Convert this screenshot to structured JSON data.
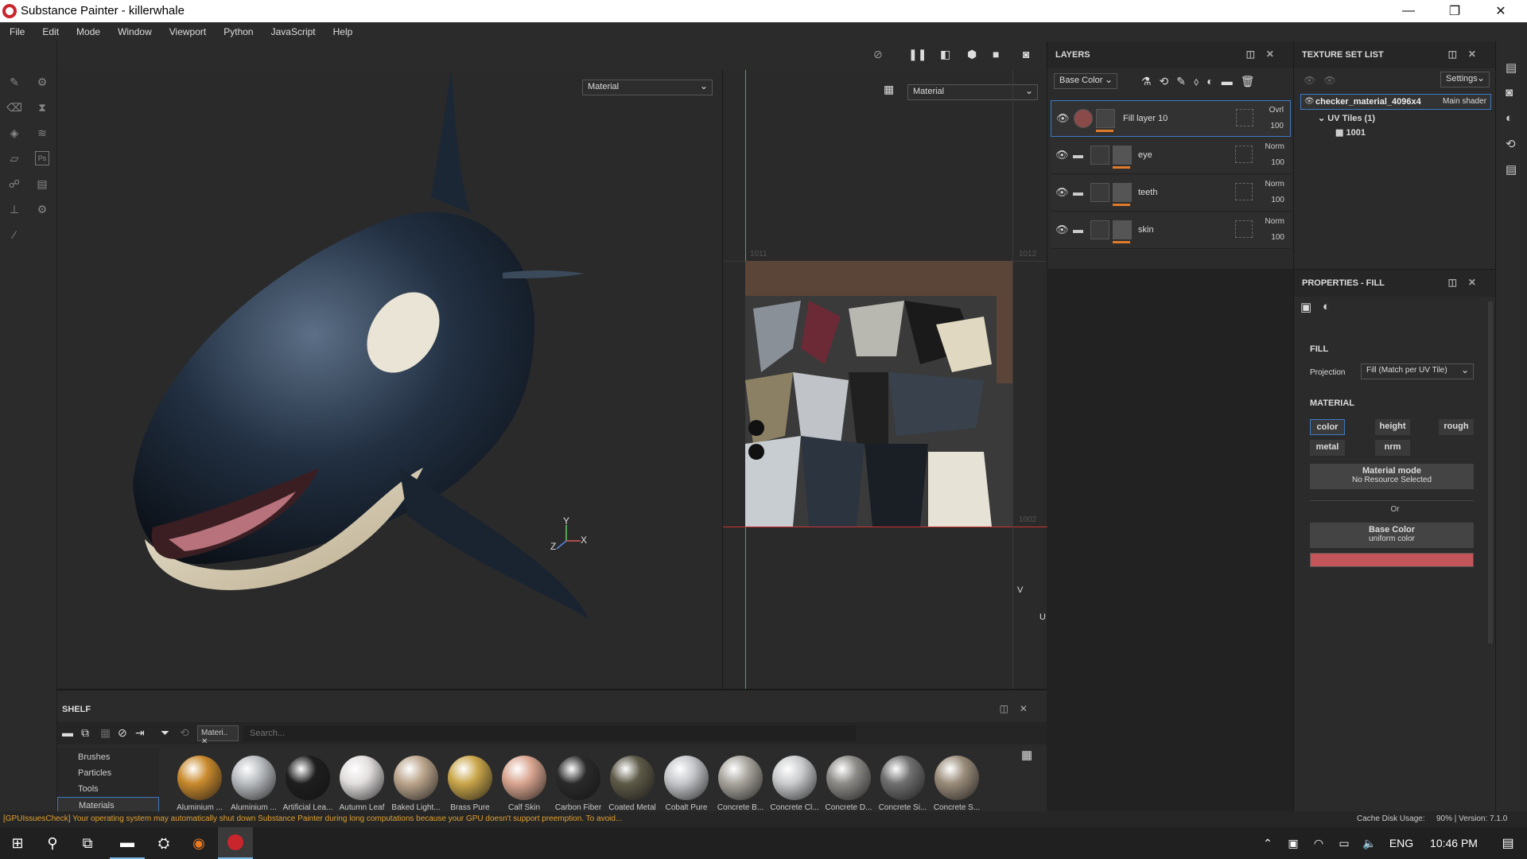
{
  "window": {
    "title": "Substance Painter - killerwhale"
  },
  "menubar": [
    "File",
    "Edit",
    "Mode",
    "Window",
    "Viewport",
    "Python",
    "JavaScript",
    "Help"
  ],
  "viewport3d": {
    "material_select": "Material",
    "axis_y": "Y",
    "axis_z": "Z",
    "axis_x": "X"
  },
  "viewport2d": {
    "material_select": "Material",
    "tile_labels": {
      "tl": "1011",
      "tr": "1012",
      "bl": "1001",
      "br": "1002"
    },
    "axis_v": "V",
    "axis_u": "U"
  },
  "layers": {
    "title": "LAYERS",
    "channel_select": "Base Color",
    "items": [
      {
        "name": "Fill layer 10",
        "blend": "Ovrl",
        "opacity": "100",
        "type": "fill"
      },
      {
        "name": "eye",
        "blend": "Norm",
        "opacity": "100",
        "type": "folder"
      },
      {
        "name": "teeth",
        "blend": "Norm",
        "opacity": "100",
        "type": "folder"
      },
      {
        "name": "skin",
        "blend": "Norm",
        "opacity": "100",
        "type": "folder"
      }
    ]
  },
  "texture_set_list": {
    "title": "TEXTURE SET LIST",
    "settings_label": "Settings",
    "set_name": "checker_material_4096x4",
    "shader": "Main shader",
    "uv_tiles": "UV Tiles (1)",
    "tile": "1001"
  },
  "properties": {
    "title": "PROPERTIES - FILL",
    "fill_section": "FILL",
    "projection_label": "Projection",
    "projection_value": "Fill (Match per UV Tile)",
    "material_section": "MATERIAL",
    "channels": [
      "color",
      "height",
      "rough",
      "metal",
      "nrm"
    ],
    "material_mode_title": "Material mode",
    "material_mode_value": "No Resource Selected",
    "or_label": "Or",
    "base_color_title": "Base Color",
    "base_color_value": "uniform color",
    "base_color_swatch": "#c4555b"
  },
  "shelf": {
    "title": "SHELF",
    "filter_tag": "Materi..",
    "search_placeholder": "Search...",
    "categories": [
      "Brushes",
      "Particles",
      "Tools",
      "Materials"
    ],
    "materials": [
      {
        "label": "Aluminium ...",
        "color": "#c98a2d"
      },
      {
        "label": "Aluminium ...",
        "color": "#b9bcc0"
      },
      {
        "label": "Artificial Lea...",
        "color": "#1e1e1e"
      },
      {
        "label": "Autumn Leaf",
        "color": "#e2dede"
      },
      {
        "label": "Baked Light...",
        "color": "#bba58c"
      },
      {
        "label": "Brass Pure",
        "color": "#c9a64a"
      },
      {
        "label": "Calf Skin",
        "color": "#d9a590"
      },
      {
        "label": "Carbon Fiber",
        "color": "#2a2a2a"
      },
      {
        "label": "Coated Metal",
        "color": "#5e5a48"
      },
      {
        "label": "Cobalt Pure",
        "color": "#c4c6c9"
      },
      {
        "label": "Concrete B...",
        "color": "#a9a59e"
      },
      {
        "label": "Concrete Cl...",
        "color": "#c9cbcc"
      },
      {
        "label": "Concrete D...",
        "color": "#8c8b88"
      },
      {
        "label": "Concrete Si...",
        "color": "#6f6f6f"
      },
      {
        "label": "Concrete S...",
        "color": "#9a8c7a"
      }
    ]
  },
  "status": {
    "warning": "[GPUIssuesCheck] Your operating system may automatically shut down Substance Painter during long computations because your GPU doesn't support preemption. To avoid...",
    "cache": "Cache Disk Usage:",
    "cache_value": "90% | Version: 7.1.0"
  },
  "taskbar": {
    "language": "ENG",
    "time": "10:46 PM"
  }
}
